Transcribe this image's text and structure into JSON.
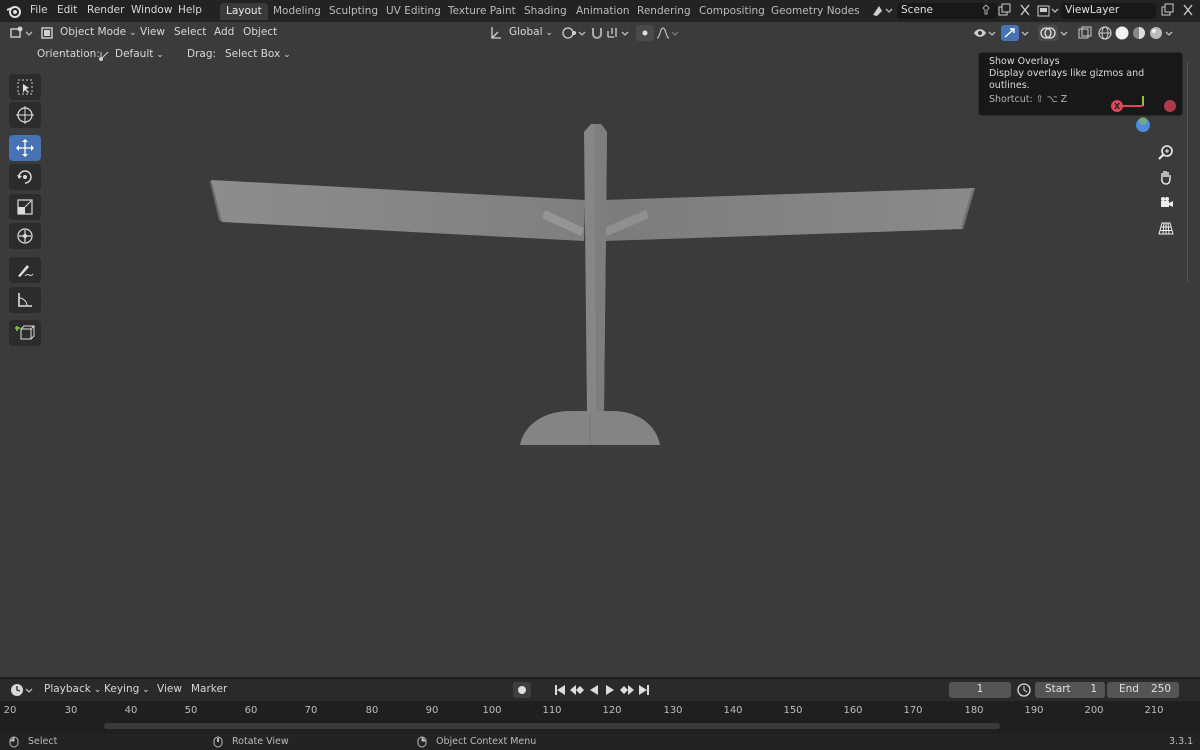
{
  "topbar": {
    "menu": [
      "File",
      "Edit",
      "Render",
      "Window",
      "Help"
    ],
    "workspaces": [
      "Layout",
      "Modeling",
      "Sculpting",
      "UV Editing",
      "Texture Paint",
      "Shading",
      "Animation",
      "Rendering",
      "Compositing",
      "Geometry Nodes"
    ],
    "active_workspace": "Layout",
    "scene": "Scene",
    "view_layer": "ViewLayer"
  },
  "viewport_header": {
    "mode": "Object Mode",
    "view": "View",
    "select": "Select",
    "add": "Add",
    "object": "Object",
    "transform_orientation": "Global",
    "orientation_label": "Orientation:",
    "orientation_value": "Default",
    "drag_label": "Drag:",
    "drag_value": "Select Box"
  },
  "tooltip": {
    "title": "Show Overlays",
    "description": "Display overlays like gizmos and outlines.",
    "shortcut": "Shortcut: ⇧ ⌥ Z"
  },
  "gizmo": {
    "x_label": "X"
  },
  "timeline": {
    "playback": "Playback",
    "keying": "Keying",
    "view": "View",
    "marker": "Marker",
    "current_frame": "1",
    "start_label": "Start",
    "start": "1",
    "end_label": "End",
    "end": "250",
    "ticks": [
      "20",
      "30",
      "40",
      "50",
      "60",
      "70",
      "80",
      "90",
      "100",
      "110",
      "120",
      "130",
      "140",
      "150",
      "160",
      "170",
      "180",
      "190",
      "200",
      "210"
    ]
  },
  "statusbar": {
    "select": "Select",
    "rotate": "Rotate View",
    "context": "Object Context Menu",
    "version": "3.3.1"
  },
  "colors": {
    "viewport_bg": "#3b3b3b",
    "active_tool": "#4772b3",
    "model": "#8a8a8a",
    "axis_x": "#e0455a",
    "axis_y": "#8bc34a",
    "axis_z": "#4d8be0"
  }
}
